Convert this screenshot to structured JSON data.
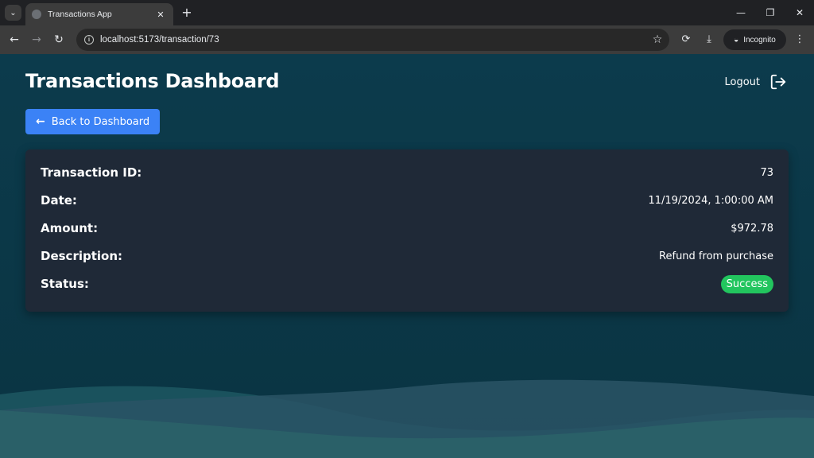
{
  "browser": {
    "tab_title": "Transactions App",
    "url": "localhost:5173/transaction/73",
    "incognito_label": "Incognito"
  },
  "header": {
    "title": "Transactions Dashboard",
    "logout_label": "Logout"
  },
  "back_button": {
    "label": "Back to Dashboard"
  },
  "transaction": {
    "rows": [
      {
        "label": "Transaction ID:",
        "value": "73"
      },
      {
        "label": "Date:",
        "value": "11/19/2024, 1:00:00 AM"
      },
      {
        "label": "Amount:",
        "value": "$972.78"
      },
      {
        "label": "Description:",
        "value": "Refund from purchase"
      },
      {
        "label": "Status:",
        "value": "Success"
      }
    ]
  },
  "colors": {
    "accent": "#3b82f6",
    "success": "#22c55e",
    "card_bg": "#1f2937",
    "page_bg": "#0c3b4c"
  },
  "icons": {
    "back": "arrow-left-icon",
    "logout": "logout-icon"
  }
}
